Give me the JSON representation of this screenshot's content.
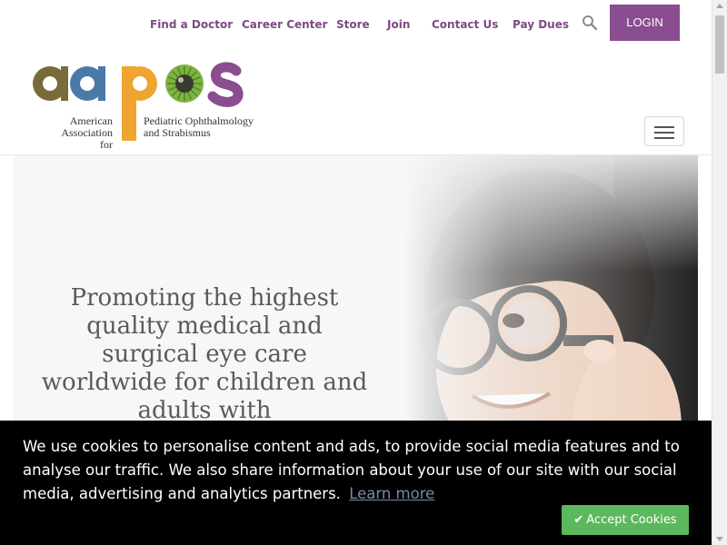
{
  "nav": {
    "items": [
      {
        "label": "Find a Doctor"
      },
      {
        "label": "Career Center"
      },
      {
        "label": "Store"
      },
      {
        "label": "Join"
      },
      {
        "label": "Contact Us"
      },
      {
        "label": "Pay Dues"
      }
    ],
    "login_label": "LOGIN",
    "search_icon": "search-icon"
  },
  "logo": {
    "wordmark": "aapos",
    "line_left_1": "American",
    "line_left_2": "Association for",
    "line_right_1": "Pediatric Ophthalmology",
    "line_right_2": "and Strabismus"
  },
  "menu_icon": "hamburger-menu-icon",
  "hero": {
    "headline": "Promoting the highest quality medical and surgical eye care worldwide for children and adults with"
  },
  "cookie": {
    "message": "We use cookies to personalise content and ads, to provide social media features and to analyse our traffic. We also share information about your use of our site with our social media, advertising and analytics partners.",
    "learn_more": "Learn more",
    "accept_label": "Accept Cookies",
    "accept_icon": "check-icon"
  },
  "colors": {
    "brand_purple": "#8a4d8f",
    "nav_text": "#7d4a83",
    "accept_green": "#5cb85c",
    "logo_brown": "#7a6a3a",
    "logo_blue": "#4a7aa8",
    "logo_orange": "#f0a530",
    "logo_green": "#7cb342",
    "logo_purple": "#8a4d8f"
  }
}
